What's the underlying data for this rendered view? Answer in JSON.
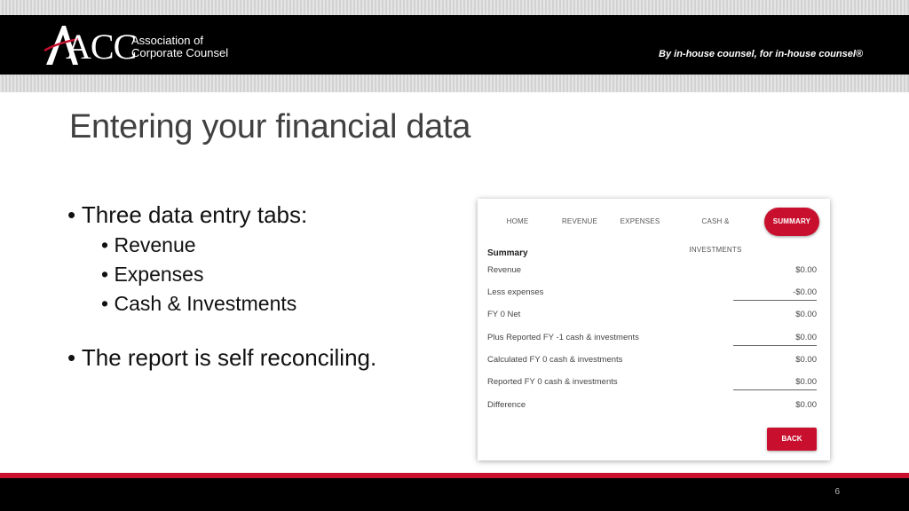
{
  "header": {
    "logo_mark": "ACC",
    "logo_line1": "Association of",
    "logo_line2": "Corporate Counsel",
    "tagline": "By in-house counsel, for in-house counsel®"
  },
  "slide": {
    "title": "Entering your financial data",
    "bullet1": "Three data entry tabs:",
    "sub_items": [
      "Revenue",
      "Expenses",
      "Cash & Investments"
    ],
    "bullet2": "The report is self reconciling."
  },
  "app": {
    "tabs": [
      "HOME",
      "REVENUE",
      "EXPENSES",
      "CASH & INVESTMENTS",
      "SUMMARY"
    ],
    "active_tab": "SUMMARY",
    "summary_heading": "Summary",
    "rows": [
      {
        "label": "Revenue",
        "value": "$0.00"
      },
      {
        "label": "Less expenses",
        "value": "-$0.00"
      },
      {
        "label": "FY 0 Net",
        "value": "$0.00"
      },
      {
        "label": "Plus Reported FY -1 cash & investments",
        "value": "$0.00"
      },
      {
        "label": "Calculated FY 0 cash & investments",
        "value": "$0.00"
      },
      {
        "label": "Reported FY 0 cash & investments",
        "value": "$0.00"
      },
      {
        "label": "Difference",
        "value": "$0.00"
      }
    ],
    "back_label": "BACK",
    "accent_color": "#c8102e"
  },
  "footer": {
    "page_number": "6"
  }
}
